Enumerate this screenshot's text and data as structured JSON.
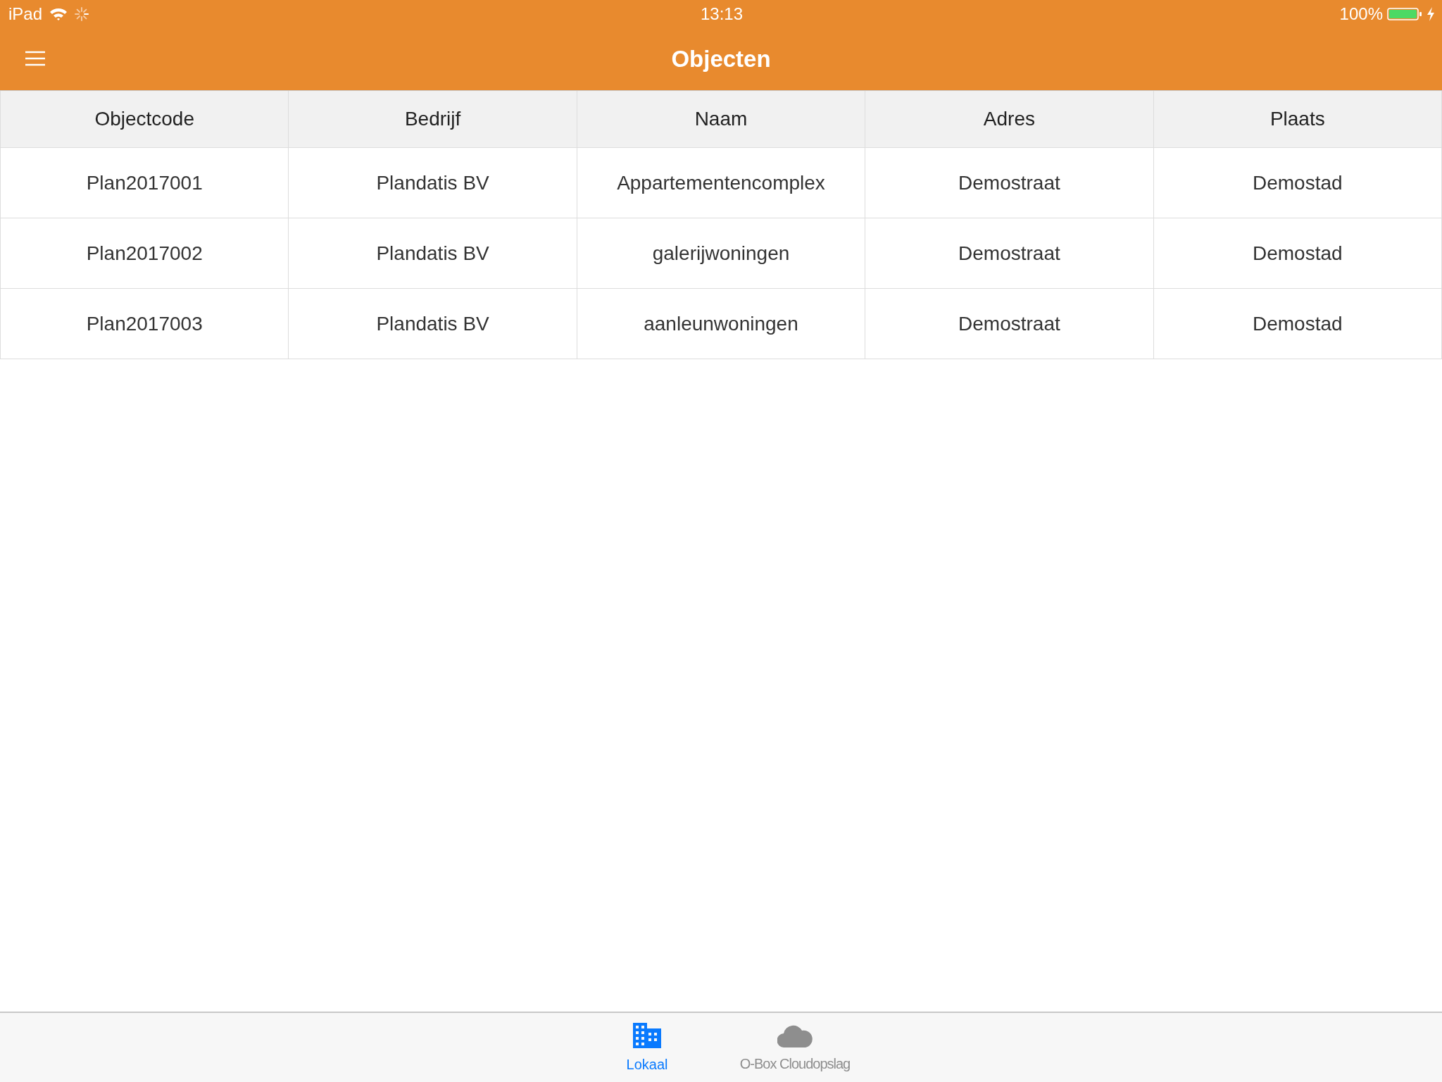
{
  "status_bar": {
    "device": "iPad",
    "time": "13:13",
    "battery": "100%"
  },
  "nav_bar": {
    "title": "Objecten"
  },
  "table": {
    "columns": [
      "Objectcode",
      "Bedrijf",
      "Naam",
      "Adres",
      "Plaats"
    ],
    "rows": [
      [
        "Plan2017001",
        "Plandatis BV",
        "Appartementencomplex",
        "Demostraat",
        "Demostad"
      ],
      [
        "Plan2017002",
        "Plandatis BV",
        "galerijwoningen",
        "Demostraat",
        "Demostad"
      ],
      [
        "Plan2017003",
        "Plandatis BV",
        "aanleunwoningen",
        "Demostraat",
        "Demostad"
      ]
    ]
  },
  "tab_bar": [
    {
      "label": "Lokaal",
      "kind": "building",
      "selected": true
    },
    {
      "label": "O-Box Cloudopslag",
      "kind": "cloud",
      "selected": false
    }
  ]
}
